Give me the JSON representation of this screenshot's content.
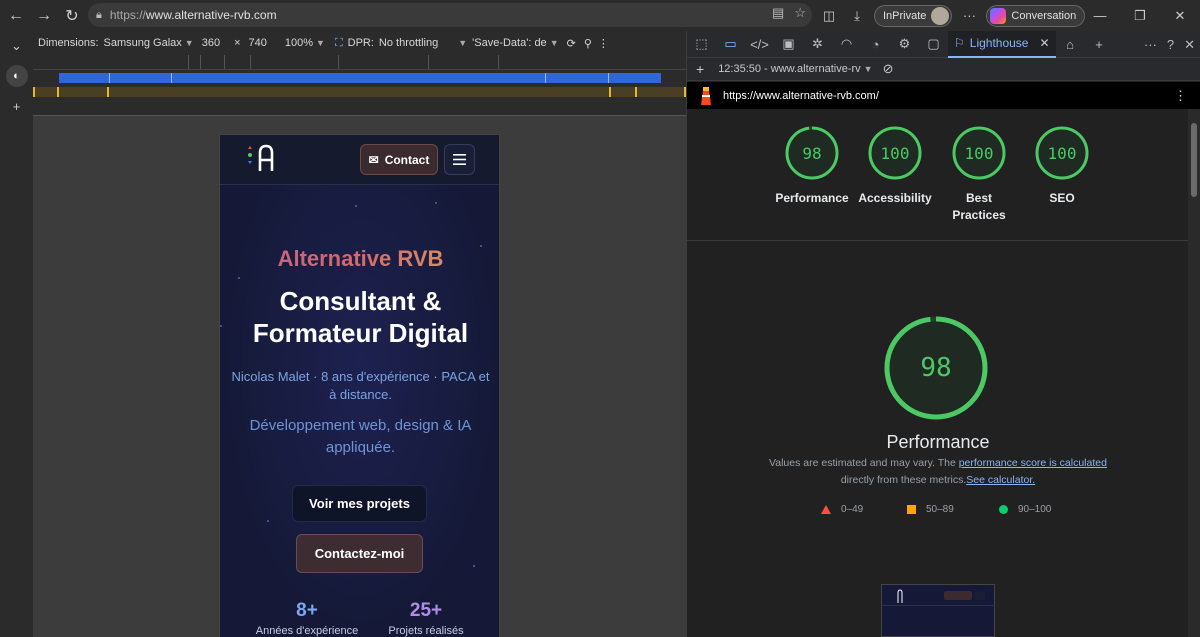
{
  "browser": {
    "url_protocol": "https://",
    "url_host": "www.alternative-rvb.com",
    "inprivate_label": "InPrivate",
    "conversation_label": "Conversation"
  },
  "device_toolbar": {
    "dimensions_label": "Dimensions:",
    "device": "Samsung Galax",
    "width": "360",
    "times": "×",
    "height": "740",
    "zoom": "100%",
    "dpr_label": "DPR:",
    "throttling": "No throttling",
    "save_data": "'Save-Data': de"
  },
  "page": {
    "contact_button": "Contact",
    "brand": "Alternative RVB",
    "title_line1": "Consultant &",
    "title_line2": "Formateur Digital",
    "subtitle": "Nicolas Malet · 8 ans d'expérience · PACA et à distance.",
    "description": "Développement web, design & IA appliquée.",
    "btn_projects": "Voir mes projets",
    "btn_contact": "Contactez-moi",
    "stats": [
      {
        "value": "8+",
        "label": "Années d'expérience",
        "color": "#7aa8f0"
      },
      {
        "value": "25+",
        "label": "Projets réalisés",
        "color": "#b08ee8"
      }
    ]
  },
  "devtools": {
    "lighthouse_tab": "Lighthouse",
    "report_time": "12:35:50 - www.alternative-rv",
    "report_url": "https://www.alternative-rvb.com/",
    "scores": [
      {
        "value": "98",
        "label": "Performance",
        "fraction": 0.98
      },
      {
        "value": "100",
        "label": "Accessibility",
        "fraction": 1.0
      },
      {
        "value": "100",
        "label": "Best Practices",
        "fraction": 1.0
      },
      {
        "value": "100",
        "label": "SEO",
        "fraction": 1.0
      }
    ],
    "perf_score": "98",
    "perf_fraction": 0.98,
    "perf_title": "Performance",
    "desc_prefix": "Values are estimated and may vary. The ",
    "desc_link1": "performance score is calculated",
    "desc_middle": " directly from these metrics.",
    "desc_link2": "See calculator.",
    "legend": [
      {
        "range": "0–49",
        "color": "#ff4e42",
        "shape": "triangle"
      },
      {
        "range": "50–89",
        "color": "#ffa400",
        "shape": "square"
      },
      {
        "range": "90–100",
        "color": "#0cce6b",
        "shape": "circle"
      }
    ],
    "score_color": "#4cc864"
  }
}
